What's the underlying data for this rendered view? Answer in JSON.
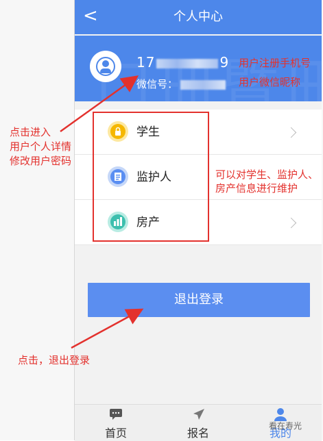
{
  "header": {
    "back_glyph": "<",
    "title": "个人中心"
  },
  "profile": {
    "phone_prefix": "17",
    "phone_suffix": "9",
    "wechat_label": "微信号：",
    "avatar_icon": "user-circle-icon"
  },
  "menu": {
    "items": [
      {
        "label": "学生",
        "icon": "lock-icon",
        "icon_color": "#f5b700"
      },
      {
        "label": "监护人",
        "icon": "id-card-icon",
        "icon_color": "#5a8ef2"
      },
      {
        "label": "房产",
        "icon": "building-icon",
        "icon_color": "#3cbfae"
      }
    ]
  },
  "logout_label": "退出登录",
  "tabbar": {
    "tabs": [
      {
        "label": "首页",
        "icon": "message-icon"
      },
      {
        "label": "报名",
        "icon": "send-icon"
      },
      {
        "label": "我的",
        "icon": "person-icon",
        "active": true
      }
    ]
  },
  "annotations": {
    "phone_note": "用户注册手机号",
    "nickname_note": "用户微信昵称",
    "click_enter": [
      "点击进入",
      "用户个人详情",
      "修改用户密码"
    ],
    "maintain_note": [
      "可以对学生、监护人、",
      "房产信息进行维护"
    ],
    "logout_note": "点击，退出登录",
    "watermark": "看在寿光"
  },
  "colors": {
    "primary": "#4d87ea",
    "annotation": "#e3312d",
    "button": "#5b8ef0"
  }
}
